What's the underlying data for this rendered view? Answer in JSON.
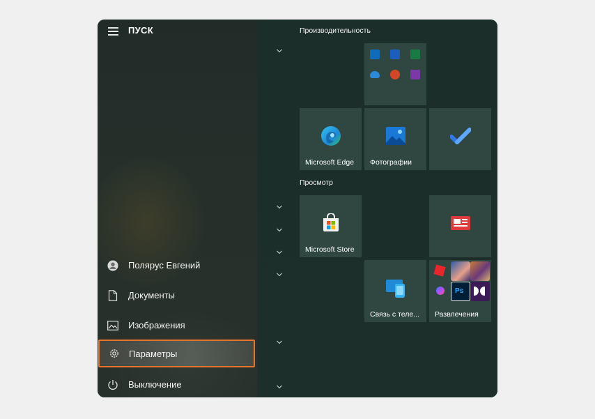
{
  "start": {
    "title": "ПУСК",
    "menu": [
      {
        "label": "Полярус Евгений",
        "icon": "user-avatar-icon"
      },
      {
        "label": "Документы",
        "icon": "document-icon"
      },
      {
        "label": "Изображения",
        "icon": "image-icon"
      },
      {
        "label": "Параметры",
        "icon": "gear-icon"
      },
      {
        "label": "Выключение",
        "icon": "power-icon"
      }
    ],
    "groups": [
      {
        "label": "Производительность"
      },
      {
        "label": "Просмотр"
      }
    ],
    "tiles": {
      "office": {
        "icons": [
          "outlook-icon",
          "word-icon",
          "excel-icon",
          "onedrive-icon",
          "powerpoint-icon",
          "onenote-icon"
        ]
      },
      "edge": {
        "label": "Microsoft Edge",
        "icon": "edge-icon"
      },
      "photos": {
        "label": "Фотографии",
        "icon": "photos-icon"
      },
      "todo": {
        "label": "",
        "icon": "todo-check-icon"
      },
      "store": {
        "label": "Microsoft Store",
        "icon": "store-icon"
      },
      "news": {
        "label": "",
        "icon": "news-icon"
      },
      "phone": {
        "label": "Связь с теле...",
        "icon": "phone-link-icon"
      },
      "entertainment": {
        "label": "Развлечения",
        "icon": "entertainment-folder-icon"
      }
    },
    "colors": {
      "highlight_border": "#e8732b",
      "tile_bg": "#2f4641",
      "panel_bg": "#1d2a26"
    }
  }
}
